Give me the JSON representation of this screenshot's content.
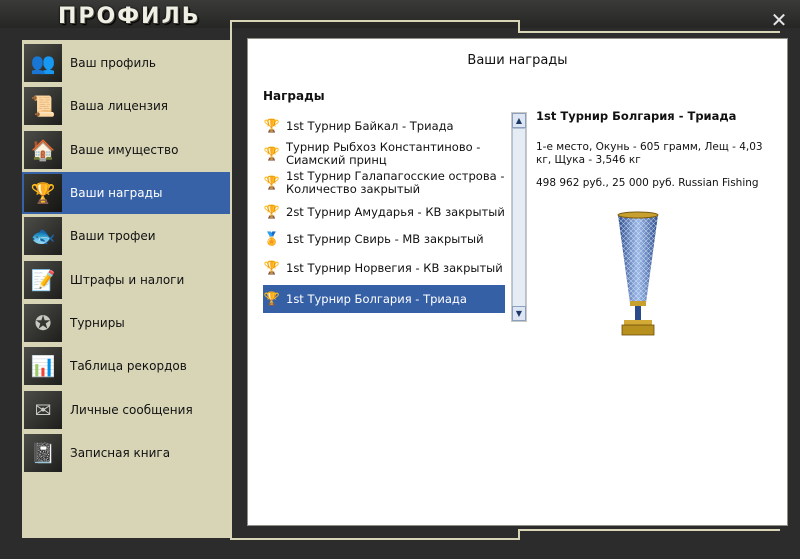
{
  "window": {
    "title": "ПРОФИЛЬ",
    "close_symbol": "✕"
  },
  "sidebar": {
    "items": [
      {
        "label": "Ваш профиль",
        "icon": "users-icon",
        "glyph": "👥",
        "active": false
      },
      {
        "label": "Ваша лицензия",
        "icon": "license-icon",
        "glyph": "📜",
        "active": false
      },
      {
        "label": "Ваше имущество",
        "icon": "house-icon",
        "glyph": "🏠",
        "active": false
      },
      {
        "label": "Ваши награды",
        "icon": "cup-icon",
        "glyph": "🏆",
        "active": true
      },
      {
        "label": "Ваши трофеи",
        "icon": "fish-icon",
        "glyph": "🐟",
        "active": false
      },
      {
        "label": "Штрафы и налоги",
        "icon": "document-edit-icon",
        "glyph": "📝",
        "active": false
      },
      {
        "label": "Турниры",
        "icon": "emblem-icon",
        "glyph": "✪",
        "active": false
      },
      {
        "label": "Таблица рекордов",
        "icon": "bar-chart-icon",
        "glyph": "📊",
        "active": false
      },
      {
        "label": "Личные сообщения",
        "icon": "envelope-icon",
        "glyph": "✉",
        "active": false
      },
      {
        "label": "Записная книга",
        "icon": "notebook-icon",
        "glyph": "📓",
        "active": false
      }
    ]
  },
  "main": {
    "title": "Ваши награды",
    "awards_header": "Награды",
    "awards": [
      {
        "label": "1st Турнир Байкал - Триада",
        "glyph": "🏆",
        "color": "#c8962c",
        "selected": false
      },
      {
        "label": "Турнир Рыбхоз Константиново - Сиамский принц",
        "glyph": "🏆",
        "color": "#8a7a50",
        "selected": false
      },
      {
        "label": "1st Турнир Галапагосские острова - Количество закрытый",
        "glyph": "🏆",
        "color": "#7a4a2a",
        "selected": false
      },
      {
        "label": "2st Турнир Амударья - КВ закрытый",
        "glyph": "🏆",
        "color": "#9a6a3a",
        "selected": false
      },
      {
        "label": "1st Турнир Свирь - МВ закрытый",
        "glyph": "🏅",
        "color": "#8a8a8a",
        "selected": false
      },
      {
        "label": "1st Турнир Норвегия - КВ закрытый",
        "glyph": "🏆",
        "color": "#6a6a5a",
        "selected": false
      },
      {
        "label": "1st Турнир Болгария - Триада",
        "glyph": "🏆",
        "color": "#c8c8d8",
        "selected": true
      }
    ],
    "detail": {
      "title": "1st Турнир Болгария - Триада",
      "description": "1-е место, Окунь - 605 грамм, Лещ - 4,03 кг, Щука - 3,546 кг",
      "prize": "498 962 руб., 25 000 руб. Russian Fishing"
    }
  },
  "colors": {
    "accent": "#3660a6",
    "sidebar_bg": "#d8d5b7",
    "frame": "#2c2c2c"
  }
}
